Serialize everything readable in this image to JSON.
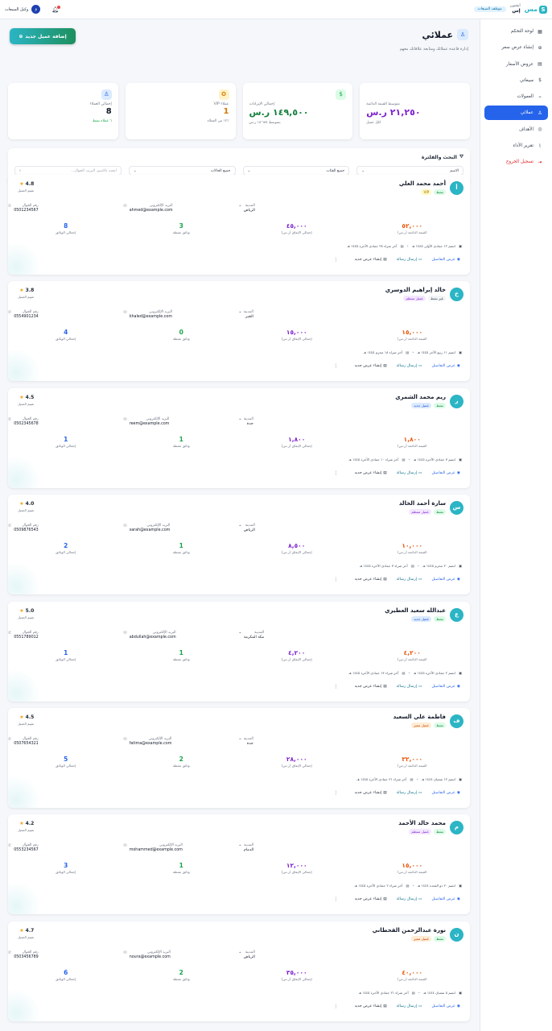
{
  "topbar": {
    "brand_letter": "S",
    "brand_text": "مس",
    "brand_sub": "ايقنون",
    "brand_name": "إس",
    "role": "موظف المبيعات",
    "user_initial": "و",
    "user_name": "وكيل المبيعات",
    "icons": {
      "bell": "bell-icon"
    }
  },
  "sidebar": {
    "items": [
      {
        "label": "لوحة التحكم",
        "icon": "▦"
      },
      {
        "label": "إنشاء عرض سعر",
        "icon": "⊕"
      },
      {
        "label": "عروض الأسعار",
        "icon": "▤"
      },
      {
        "label": "مبيعاتي",
        "icon": "$"
      },
      {
        "label": "العمولات",
        "icon": "⌁"
      },
      {
        "label": "عملائي",
        "icon": "♙"
      },
      {
        "label": "الأهداف",
        "icon": "◎"
      },
      {
        "label": "تقرير الأداء",
        "icon": "⌇"
      },
      {
        "label": "تسجيل الخروج",
        "icon": "⇥"
      }
    ]
  },
  "page": {
    "title": "عملائي",
    "subtitle": "إدارة قاعدة عملائك ومتابعة علاقاتك معهم",
    "add_button": "إضافة عميل جديد"
  },
  "stats": [
    {
      "label": "إجمالي العملاء",
      "value": "8",
      "note": "٦ عملاء نشط"
    },
    {
      "label": "عملاء VIP",
      "value": "1",
      "note": "٪١٢ من العملاء"
    },
    {
      "label": "إجمالي الإيرادات",
      "value": "١٤٩,٥٠٠ ر.س",
      "note": "بمتوسط ١٨٬٦٨٧ ر.س"
    },
    {
      "label": "متوسط القيمة الدائمة",
      "value": "٢١,٢٥٠ ر.س",
      "note": "لكل عميل"
    }
  ],
  "filter": {
    "title": "البحث والفلترة",
    "search_placeholder": "ابحث بالاسم، البريد، الجوال...",
    "status": "جميع الحالات",
    "category": "جميع الفئات",
    "sort": "الاسم"
  },
  "labels": {
    "phone": "رقم الجوال",
    "email": "البريد الإلكتروني",
    "city": "المدينة",
    "total_docs": "إجمالي الوثائق",
    "active_docs": "وثائق نشطة",
    "total_spent": "إجمالي الإنفاق (ر.س)",
    "lifetime_value": "القيمة الدائمة (ر.س)",
    "rating": "تقييم العميل",
    "view": "عرض التفاصيل",
    "message": "إرسال رسالة",
    "new_quote": "إنشاء عرض جديد"
  },
  "clients": [
    {
      "initial": "أ",
      "name": "أحمد محمد العلي",
      "status": "نشط",
      "tag": "VIP",
      "tag_class": "vip",
      "rating": "4.8",
      "phone": "0501234567",
      "email": "ahmed@example.com",
      "city": "الرياض",
      "total_docs": "8",
      "active_docs": "3",
      "spent": "٤٥,٠٠٠",
      "ltv": "٥٢,٠٠٠",
      "joined": "انضم ١٢ جمادى الأولى ١٤٤٥ هـ",
      "last": "آخر شراء ٢٨ جمادى الآخرة ١٤٤٥ هـ"
    },
    {
      "initial": "خ",
      "name": "خالد إبراهيم الدوسري",
      "status": "غير نشط",
      "tag": "عميل منتظم",
      "tag_class": "regular",
      "rating": "3.8",
      "phone": "0554901234",
      "email": "khaled@example.com",
      "city": "الخبر",
      "total_docs": "4",
      "active_docs": "0",
      "spent": "١٥,٠٠٠",
      "ltv": "١٥,٠٠٠",
      "joined": "انضم ١١ ربيع الآخر ١٤٤٥ هـ",
      "last": "آخر شراء ١٨ محرم ١٤٤٥ هـ"
    },
    {
      "initial": "ر",
      "name": "ريم محمد الشمري",
      "status": "نشط",
      "tag": "عميل جديد",
      "tag_class": "new",
      "rating": "4.5",
      "phone": "0502345678",
      "email": "reem@example.com",
      "city": "جدة",
      "total_docs": "1",
      "active_docs": "1",
      "spent": "١,٨٠٠",
      "ltv": "١,٨٠٠",
      "joined": "انضم ٧ جمادى الآخرة ١٤٤٥ هـ",
      "last": "آخر شراء ١٠ جمادى الآخرة ١٤٤٥ هـ"
    },
    {
      "initial": "س",
      "name": "سارة أحمد الخالد",
      "status": "نشط",
      "tag": "عميل منتظم",
      "tag_class": "regular",
      "rating": "4.0",
      "phone": "0509876543",
      "email": "sarah@example.com",
      "city": "الرياض",
      "total_docs": "2",
      "active_docs": "1",
      "spent": "٨,٥٠٠",
      "ltv": "١٠,٠٠٠",
      "joined": "انضم ٢٠ محرم ١٤٤٥ هـ",
      "last": "آخر شراء ٧ جمادى الآخرة ١٤٤٥ هـ"
    },
    {
      "initial": "ع",
      "name": "عبدالله سعيد العطيري",
      "status": "نشط",
      "tag": "عميل جديد",
      "tag_class": "new",
      "rating": "5.0",
      "phone": "0551789012",
      "email": "abdullah@example.com",
      "city": "مكة المكرمة",
      "total_docs": "1",
      "active_docs": "1",
      "spent": "٤,٢٠٠",
      "ltv": "٤,٢٠٠",
      "joined": "انضم ٢ جمادى الآخرة ١٤٤٥ هـ",
      "last": "آخر شراء ١٣ جمادى الآخرة ١٤٤٥ هـ"
    },
    {
      "initial": "ف",
      "name": "فاطمة علي السعيد",
      "status": "نشط",
      "tag": "عميل مميز",
      "tag_class": "hot",
      "rating": "4.5",
      "phone": "0507654321",
      "email": "fatima@example.com",
      "city": "جدة",
      "total_docs": "5",
      "active_docs": "2",
      "spent": "٢٨,٠٠٠",
      "ltv": "٣٢,٠٠٠",
      "joined": "انضم ١٢ شعبان ١٤٤٤ هـ",
      "last": "آخر شراء ٢١ جمادى الآخرة ١٤٤٥ هـ"
    },
    {
      "initial": "م",
      "name": "محمد خالد الأحمد",
      "status": "نشط",
      "tag": "عميل منتظم",
      "tag_class": "regular",
      "rating": "4.2",
      "phone": "0553234567",
      "email": "mohammed@example.com",
      "city": "الدمام",
      "total_docs": "3",
      "active_docs": "1",
      "spent": "١٢,٠٠٠",
      "ltv": "١٥,٠٠٠",
      "joined": "انضم ٢٠ ذو القعدة ١٤٤٤ هـ",
      "last": "آخر شراء ٢ جمادى الآخرة ١٤٤٥ هـ"
    },
    {
      "initial": "ن",
      "name": "نورة عبدالرحمن القحطاني",
      "status": "نشط",
      "tag": "عميل مميز",
      "tag_class": "hot",
      "rating": "4.7",
      "phone": "0503456789",
      "email": "noura@example.com",
      "city": "الرياض",
      "total_docs": "6",
      "active_docs": "2",
      "spent": "٣٥,٠٠٠",
      "ltv": "٤٠,٠٠٠",
      "joined": "انضم ٥ شعبان ١٤٤٤ هـ",
      "last": "آخر شراء ٢١ جمادى الآخرة ١٤٤٥ هـ"
    }
  ]
}
